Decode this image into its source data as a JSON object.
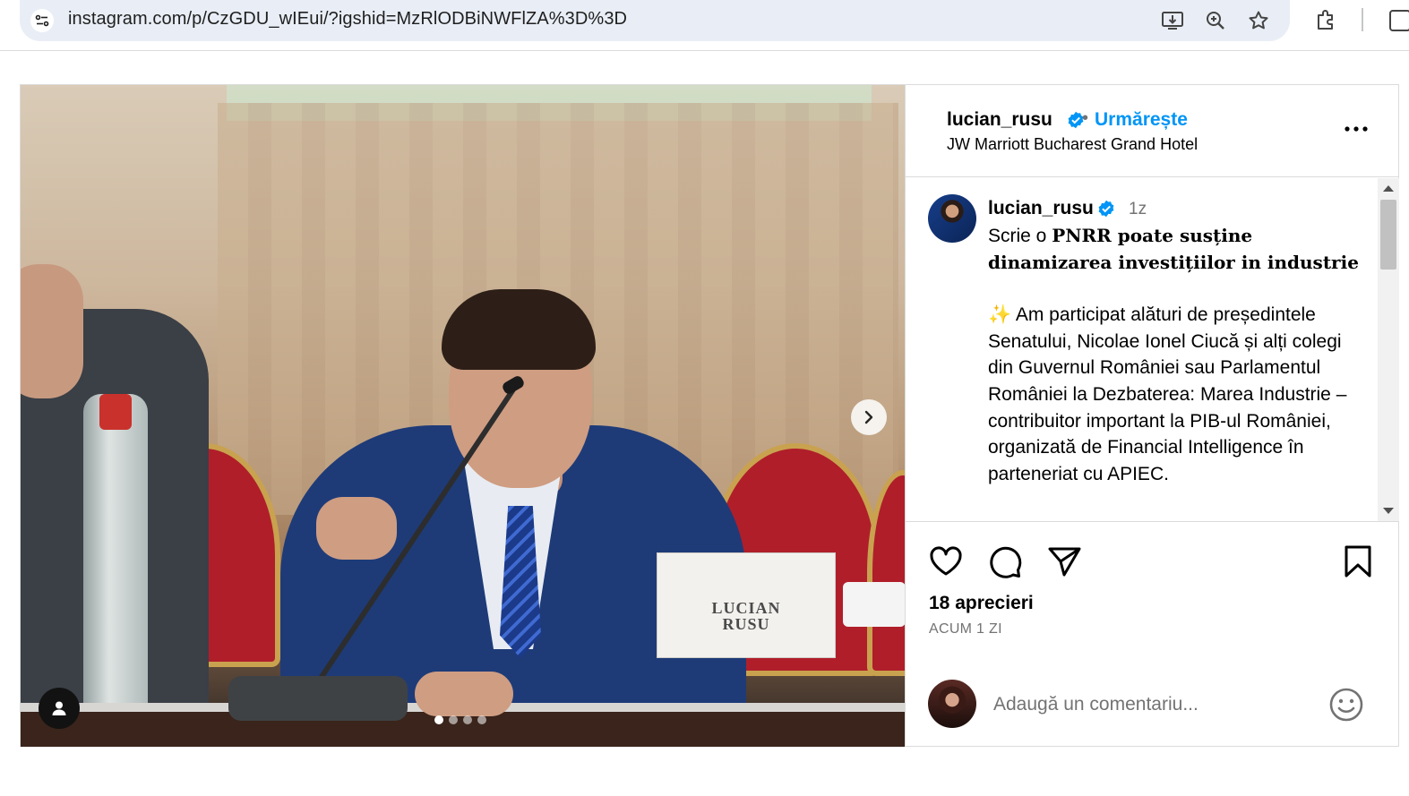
{
  "browser": {
    "url": "instagram.com/p/CzGDU_wIEui/?igshid=MzRlODBiNWFlZA%3D%3D",
    "icons": [
      "site-info-icon",
      "install-app-icon",
      "zoom-icon",
      "bookmark-star-icon",
      "extensions-icon",
      "profile-icon"
    ]
  },
  "post": {
    "header": {
      "username": "lucian_rusu",
      "separator": "•",
      "follow_label": "Urmărește",
      "location": "JW Marriott Bucharest Grand Hotel"
    },
    "media": {
      "nameplate_line1": "LUCIAN",
      "nameplate_line2": "RUSU",
      "slide_count": 4,
      "active_slide": 1
    },
    "caption": {
      "username": "lucian_rusu",
      "time": "1z",
      "prefix": "Scrie o ",
      "headline": "PNRR poate susține dinamizarea investițiilor in industrie",
      "emoji": "✨",
      "body": "Am participat alături de președintele Senatului, Nicolae Ionel Ciucă și alți colegi din Guvernul României sau Parlamentul României la Dezbaterea: Marea Industrie – contribuitor important la PIB-ul României, organizată de Financial Intelligence în parteneriat cu APIEC."
    },
    "likes": "18 aprecieri",
    "date": "ACUM 1 ZI",
    "comment_placeholder": "Adaugă un comentariu..."
  },
  "colors": {
    "accent": "#0095f6",
    "verified": "#0095f6",
    "muted": "#737373",
    "border": "#dbdbdb"
  }
}
